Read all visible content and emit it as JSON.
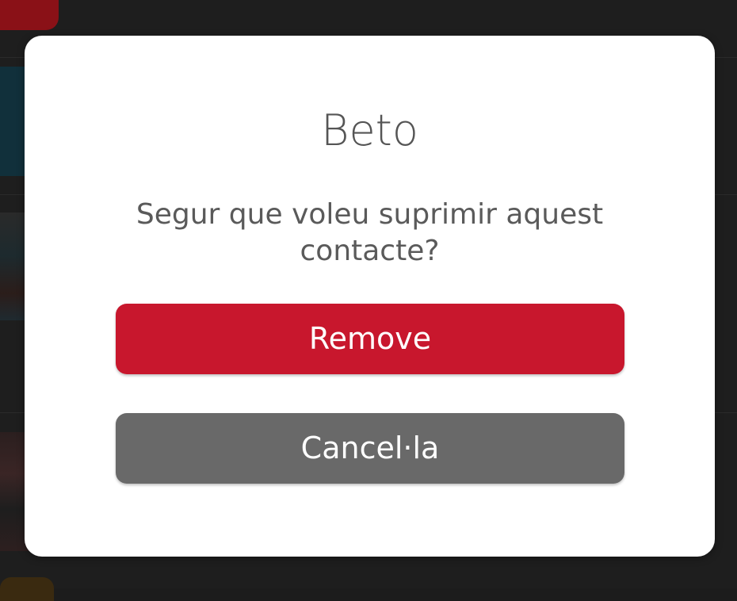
{
  "dialog": {
    "title": "Beto",
    "message": "Segur que voleu suprimir aquest contacte?",
    "remove_label": "Remove",
    "cancel_label": "Cancel·la"
  },
  "colors": {
    "remove_button": "#c8172d",
    "cancel_button": "#696969",
    "dialog_background": "#ffffff",
    "overlay": "#1e1e1e"
  }
}
